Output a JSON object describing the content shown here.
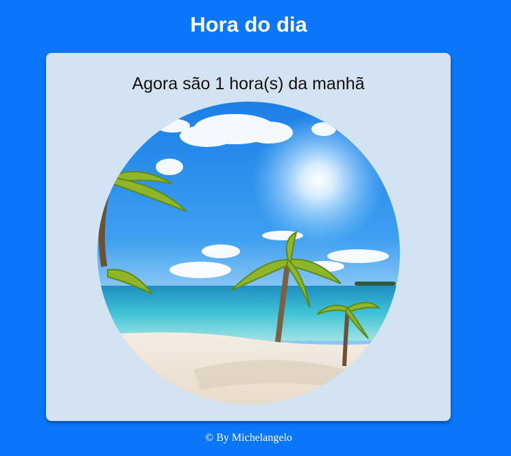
{
  "header": {
    "title": "Hora do dia"
  },
  "card": {
    "message": "Agora são 1 hora(s) da manhã",
    "image_icon": "beach-palm-trees-image"
  },
  "footer": {
    "copyright": "© By Michelangelo"
  },
  "colors": {
    "background": "#0a77fb",
    "card": "#d4e3f1",
    "text_light": "#ffffff",
    "text_dark": "#111111"
  }
}
